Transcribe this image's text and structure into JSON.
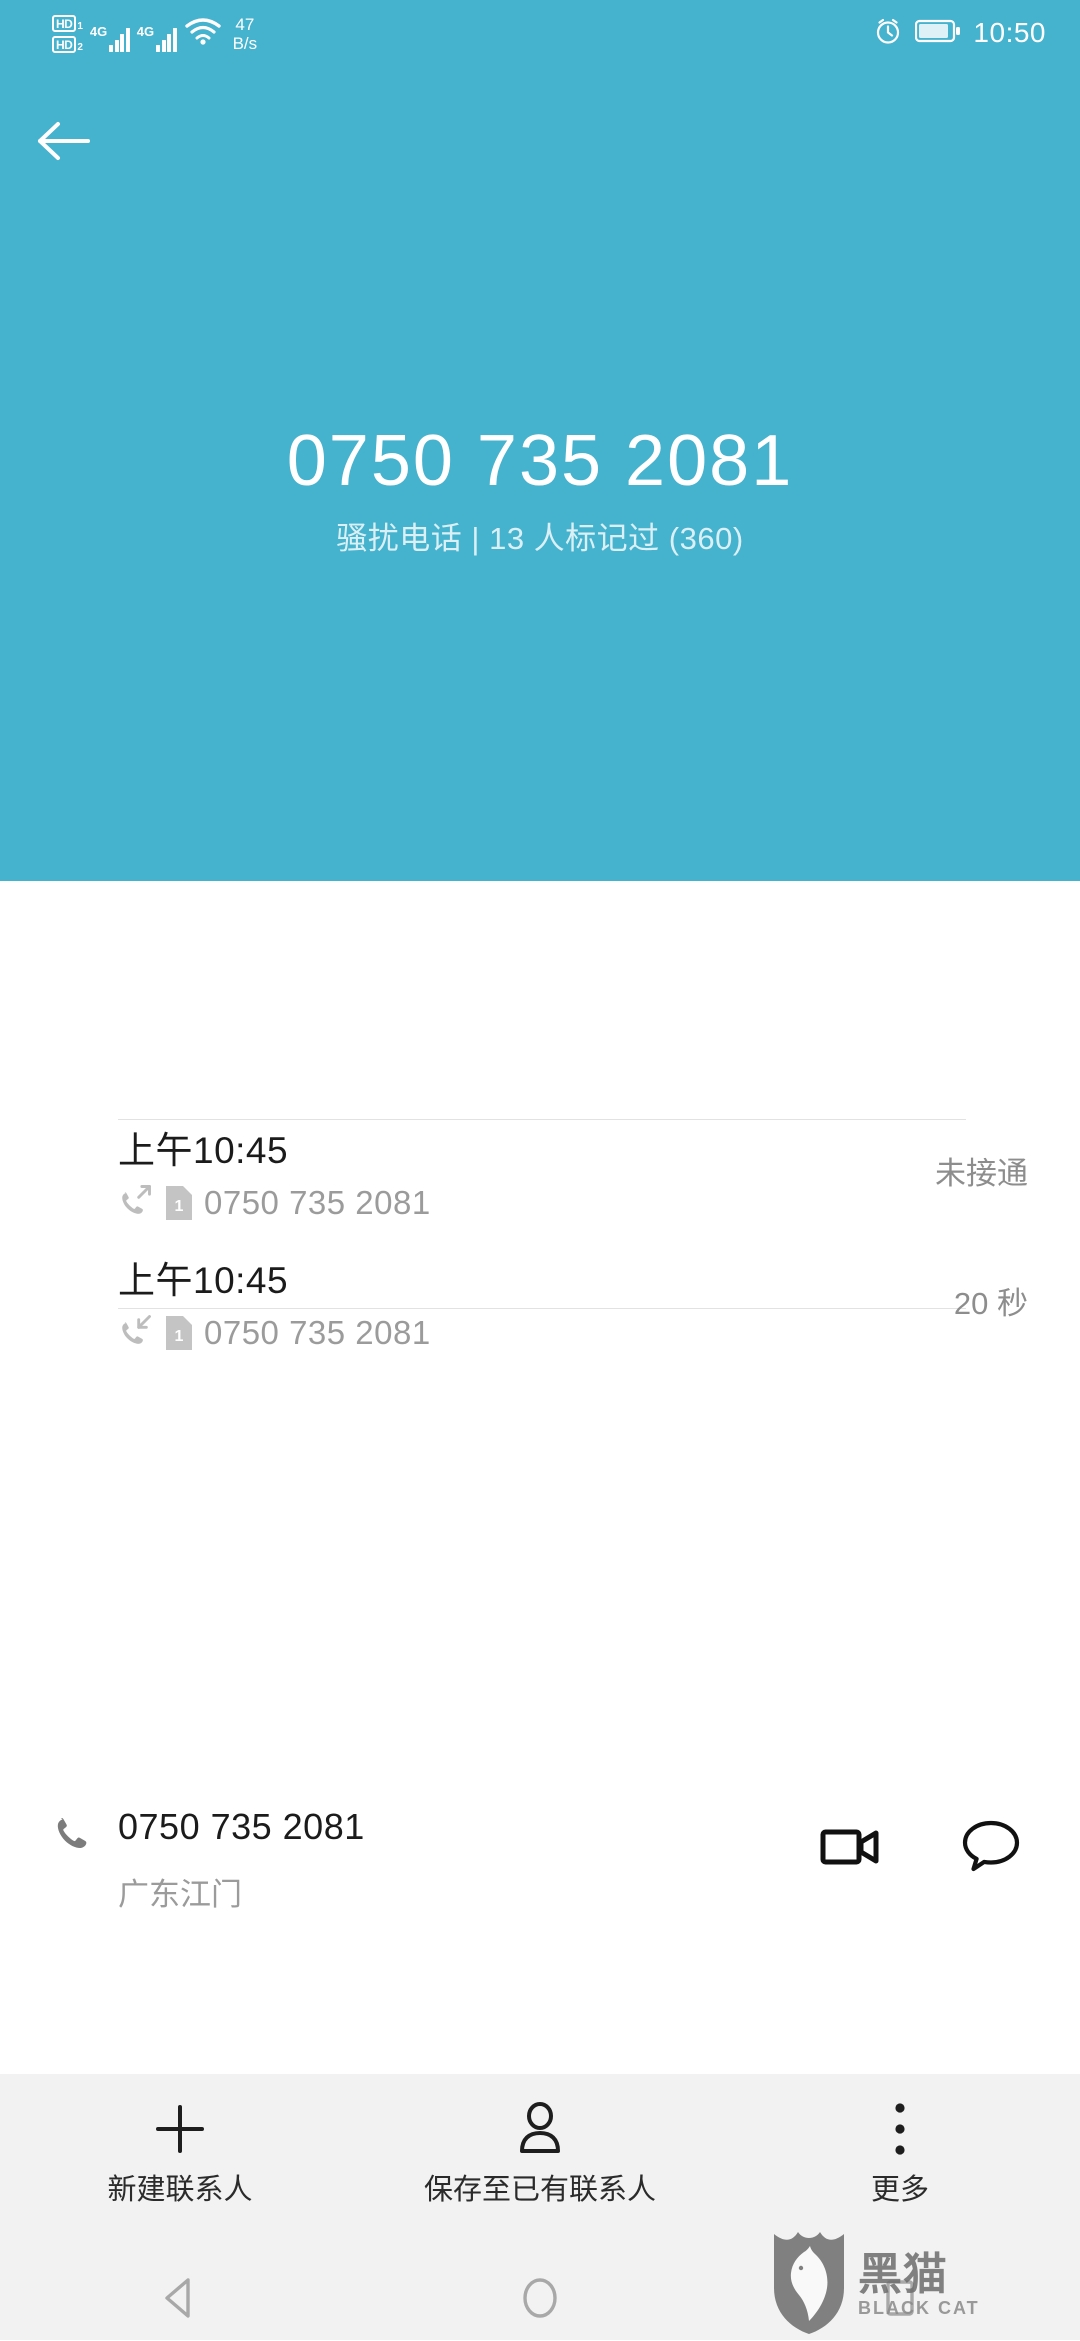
{
  "statusbar": {
    "hd1_label": "HD",
    "hd1_sub": "1",
    "hd2_label": "HD",
    "hd2_sub": "2",
    "sim1_network": "4G",
    "sim2_network": "4G",
    "net_speed_value": "47",
    "net_speed_unit": "B/s",
    "alarm_icon": "alarm-clock-icon",
    "battery_icon": "battery-icon",
    "wifi_icon": "wifi-icon",
    "time": "10:50"
  },
  "header": {
    "back_icon": "back-arrow-icon",
    "phone_number": "0750 735 2081",
    "spam_label": "骚扰电话 | 13 人标记过 (360)",
    "background_color": "#45b2ce"
  },
  "contact": {
    "phone_icon": "phone-handset-icon",
    "number": "0750 735 2081",
    "location": "广东江门",
    "video_icon": "video-call-icon",
    "message_icon": "message-bubble-icon"
  },
  "call_log": [
    {
      "time": "上午10:45",
      "direction_icon": "outgoing-call-icon",
      "sim_badge": "1",
      "number": "0750 735 2081",
      "status": "未接通"
    },
    {
      "time": "上午10:45",
      "direction_icon": "incoming-call-icon",
      "sim_badge": "1",
      "number": "0750 735 2081",
      "status": "20 秒"
    }
  ],
  "actionbar": {
    "items": [
      {
        "icon": "plus-icon",
        "label": "新建联系人"
      },
      {
        "icon": "person-icon",
        "label": "保存至已有联系人"
      },
      {
        "icon": "more-vertical-icon",
        "label": "更多"
      }
    ]
  },
  "navbar": {
    "back_icon": "nav-back-triangle-icon",
    "home_icon": "nav-home-circle-icon",
    "recents_icon": "nav-recents-square-icon"
  },
  "watermark": {
    "cn": "黑猫",
    "en": "BLACK CAT",
    "logo_icon": "black-cat-shield-logo"
  }
}
